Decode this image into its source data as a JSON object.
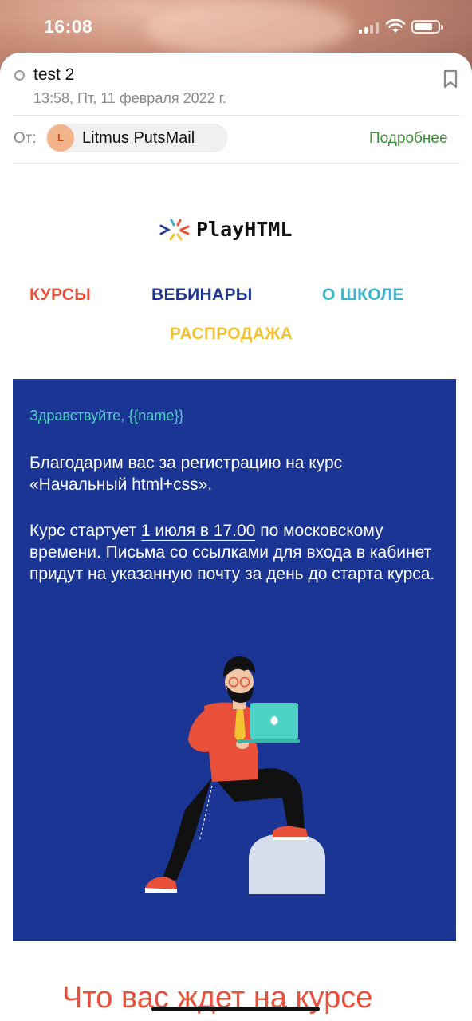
{
  "status_bar": {
    "time": "16:08"
  },
  "email": {
    "subject": "test 2",
    "date": "13:58, Пт, 11 февраля 2022 г.",
    "from_label": "От:",
    "sender_initial": "L",
    "sender_name": "Litmus PutsMail",
    "details_label": "Подробнее"
  },
  "newsletter": {
    "logo_text": "PlayHTML",
    "nav": {
      "courses": "КУРСЫ",
      "webinars": "ВЕБИНАРЫ",
      "school": "О ШКОЛЕ",
      "sale": "РАСПРОДАЖА"
    },
    "greeting": "Здравствуйте, {{name}}",
    "thanks_text": "Благодарим вас за регистрацию на курс «Начальный html+css».",
    "start_prefix": "Курс стартует ",
    "start_highlight": "1 июля в 17.00",
    "start_suffix": " по московскому времени. Письма со ссылками для входа в кабинет придут на указанную почту за день до старта курса.",
    "section_title": "Что вас ждет на курсе"
  },
  "colors": {
    "card_bg": "#1a3594",
    "accent_red": "#e8503a",
    "accent_teal": "#3cb3c8",
    "accent_yellow": "#f2c230",
    "details_green": "#3e8e3c"
  }
}
